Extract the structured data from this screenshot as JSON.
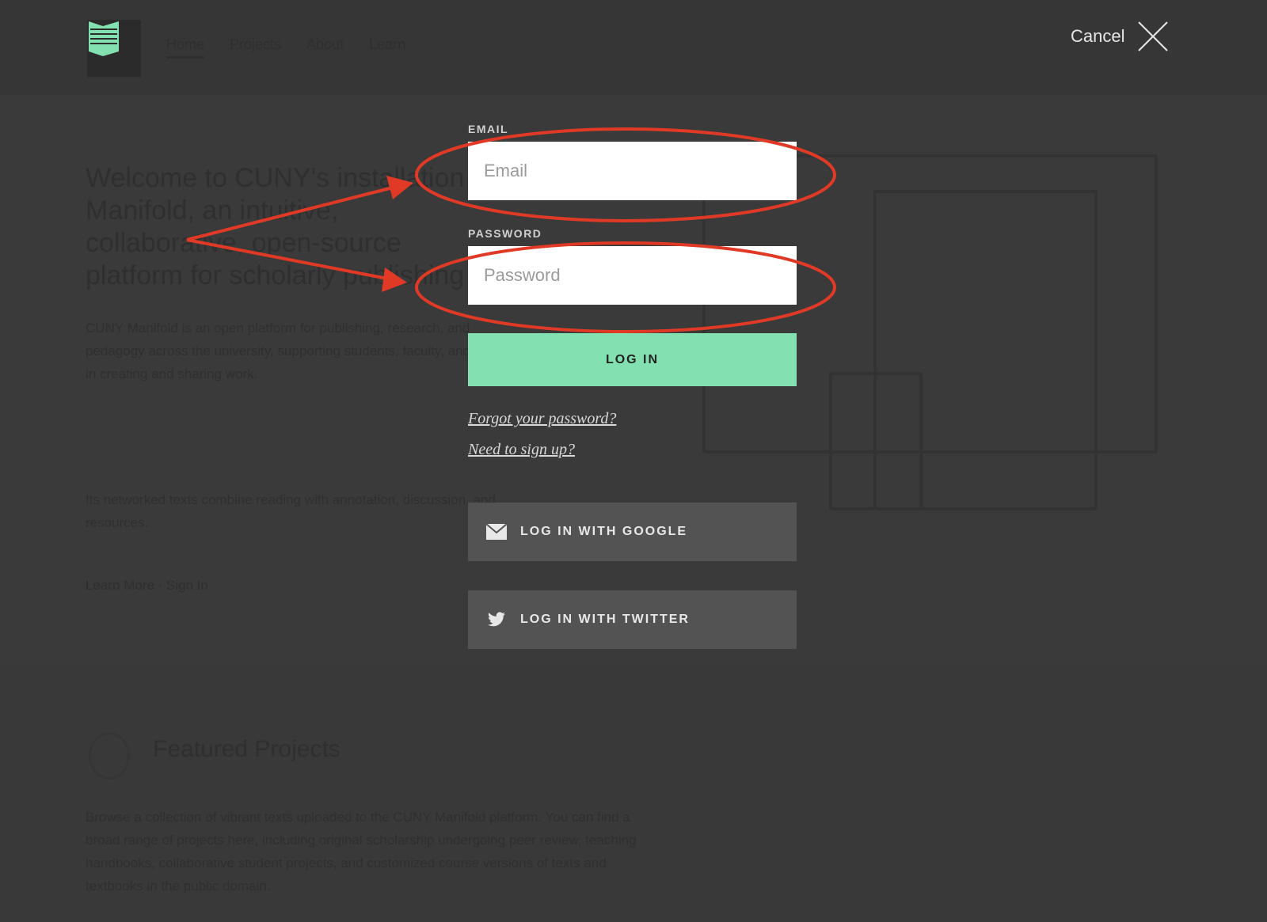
{
  "background": {
    "nav": [
      "Home",
      "Projects",
      "About",
      "Learn"
    ],
    "hero_title": "Welcome to CUNY's installation of Manifold, an intuitive, collaborative, open-source platform for scholarly publishing",
    "hero_body": "CUNY Manifold is an open platform for publishing, research, and pedagogy across the university, supporting students, faculty, and staff in creating and sharing work.",
    "hero_body2": "Its networked texts combine reading with annotation, discussion, and resources.",
    "hero_links": "Learn More · Sign In",
    "featured_title": "Featured Projects",
    "featured_body": "Browse a collection of vibrant texts uploaded to the CUNY Manifold platform. You can find a broad range of projects here, including original scholarship undergoing peer review, teaching handbooks, collaborative student projects, and customized course versions of texts and textbooks in the public domain."
  },
  "cancel": {
    "label": "Cancel",
    "icon": "close-icon"
  },
  "login": {
    "email_label": "EMAIL",
    "email_placeholder": "Email",
    "email_value": "",
    "password_label": "PASSWORD",
    "password_placeholder": "Password",
    "password_value": "",
    "submit_label": "LOG IN",
    "forgot_link": "Forgot your password?",
    "signup_link": "Need to sign up?",
    "google_label": "LOG IN WITH GOOGLE",
    "google_icon": "envelope-icon",
    "twitter_label": "LOG IN WITH TWITTER",
    "twitter_icon": "twitter-bird-icon"
  },
  "colors": {
    "overlay_bg": "#3a3a3a",
    "accent_green": "#83e0b0",
    "oauth_button_bg": "#535353",
    "annotation_red": "#e03a26"
  }
}
